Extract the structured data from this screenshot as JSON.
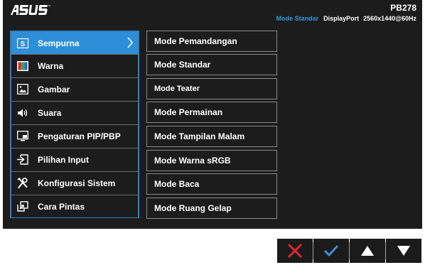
{
  "header": {
    "brand": "ASUS",
    "model": "PB278",
    "mode": "Mode Standar",
    "input": "DisplayPort",
    "resolution": "2560x1440@60Hz"
  },
  "main_menu": {
    "items": [
      {
        "label": "Sempurna",
        "icon": "splendid-icon",
        "active": true
      },
      {
        "label": "Warna",
        "icon": "color-icon"
      },
      {
        "label": "Gambar",
        "icon": "image-icon"
      },
      {
        "label": "Suara",
        "icon": "speaker-icon"
      },
      {
        "label": "Pengaturan PIP/PBP",
        "icon": "pip-icon"
      },
      {
        "label": "Pilihan Input",
        "icon": "input-select-icon"
      },
      {
        "label": "Konfigurasi Sistem",
        "icon": "tools-icon"
      },
      {
        "label": "Cara Pintas",
        "icon": "shortcut-icon"
      }
    ]
  },
  "sub_menu": {
    "items": [
      {
        "label": "Mode Pemandangan"
      },
      {
        "label": "Mode Standar"
      },
      {
        "label": "Mode Teater"
      },
      {
        "label": "Mode Permainan"
      },
      {
        "label": "Mode Tampilan Malam"
      },
      {
        "label": "Mode Warna sRGB"
      },
      {
        "label": "Mode Baca"
      },
      {
        "label": "Mode Ruang Gelap"
      }
    ]
  },
  "colors": {
    "accent": "#2e8fd8",
    "status_mode": "#2e9ad8",
    "close": "#e0262d",
    "confirm": "#3d8fd6"
  },
  "buttons": [
    {
      "icon": "close-icon"
    },
    {
      "icon": "check-icon"
    },
    {
      "icon": "up-arrow-icon"
    },
    {
      "icon": "down-arrow-icon"
    }
  ]
}
